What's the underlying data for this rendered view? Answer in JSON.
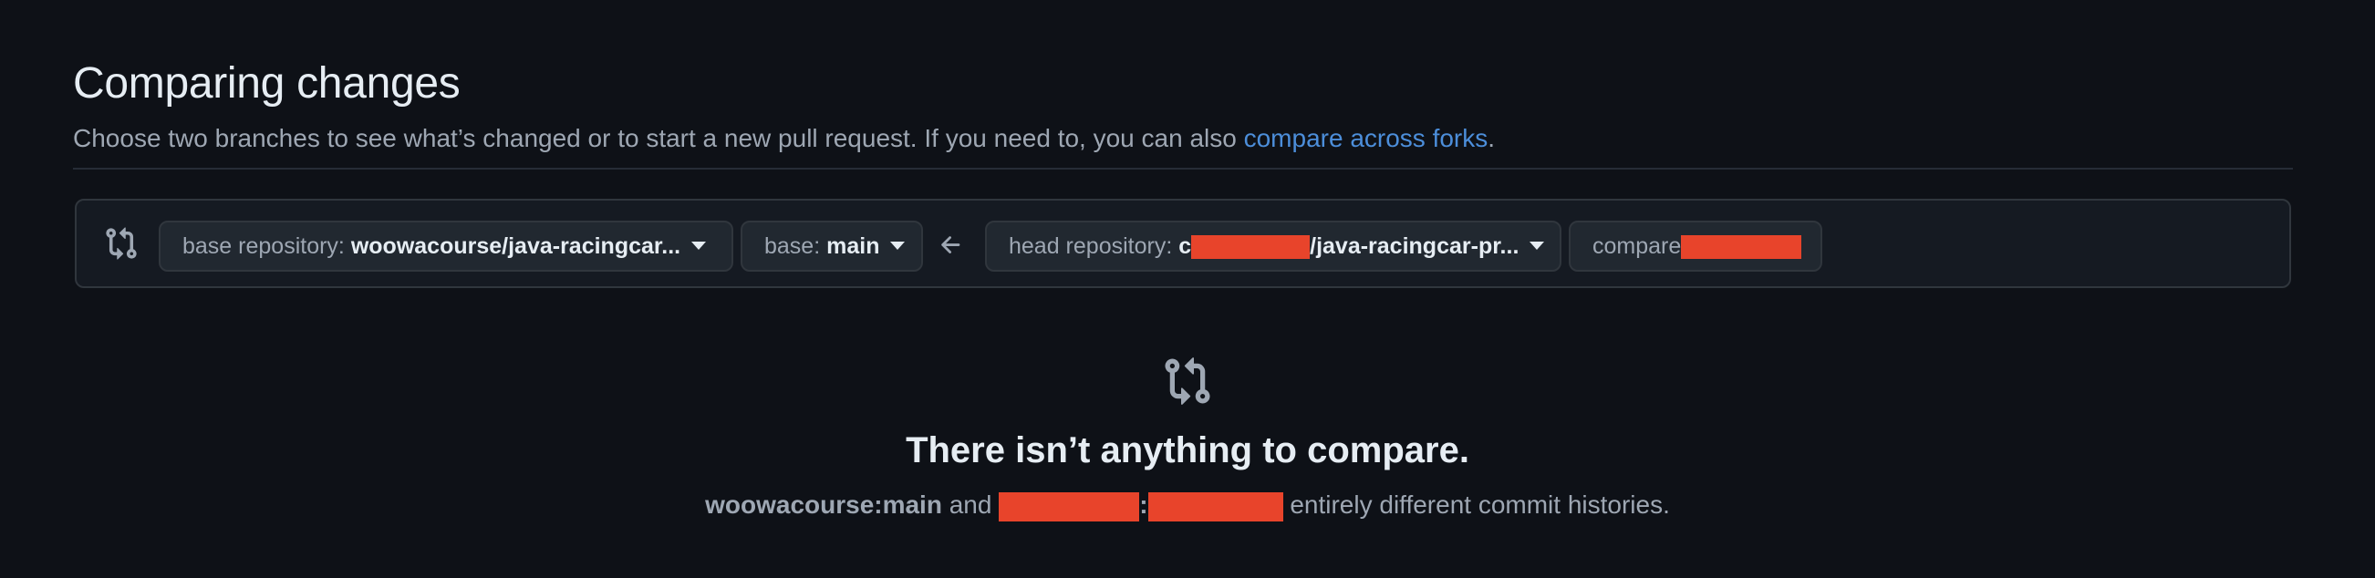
{
  "header": {
    "title": "Comparing changes",
    "subtitle_text": "Choose two branches to see what’s changed or to start a new pull request. If you need to, you can also ",
    "subtitle_link": "compare across forks",
    "subtitle_end": "."
  },
  "range": {
    "base_repo_label": "base repository: ",
    "base_repo_value": "woowacourse/java-racingcar...",
    "base_label": "base: ",
    "base_value": "main",
    "head_repo_label": "head repository: ",
    "head_repo_prefix": "c",
    "head_repo_value": "/java-racingcar-pr...",
    "compare_label": "compare"
  },
  "blank": {
    "title": "There isn’t anything to compare.",
    "base_ref": "woowacourse:main",
    "and_text": " and ",
    "colon": ":",
    "suffix": " entirely different commit histories."
  },
  "colors": {
    "background": "#0e1117",
    "link": "#4c8eda",
    "redaction": "#e8442b"
  },
  "icons": {
    "range": "git-compare-icon",
    "direction": "arrow-left-icon",
    "blank": "git-compare-icon"
  }
}
